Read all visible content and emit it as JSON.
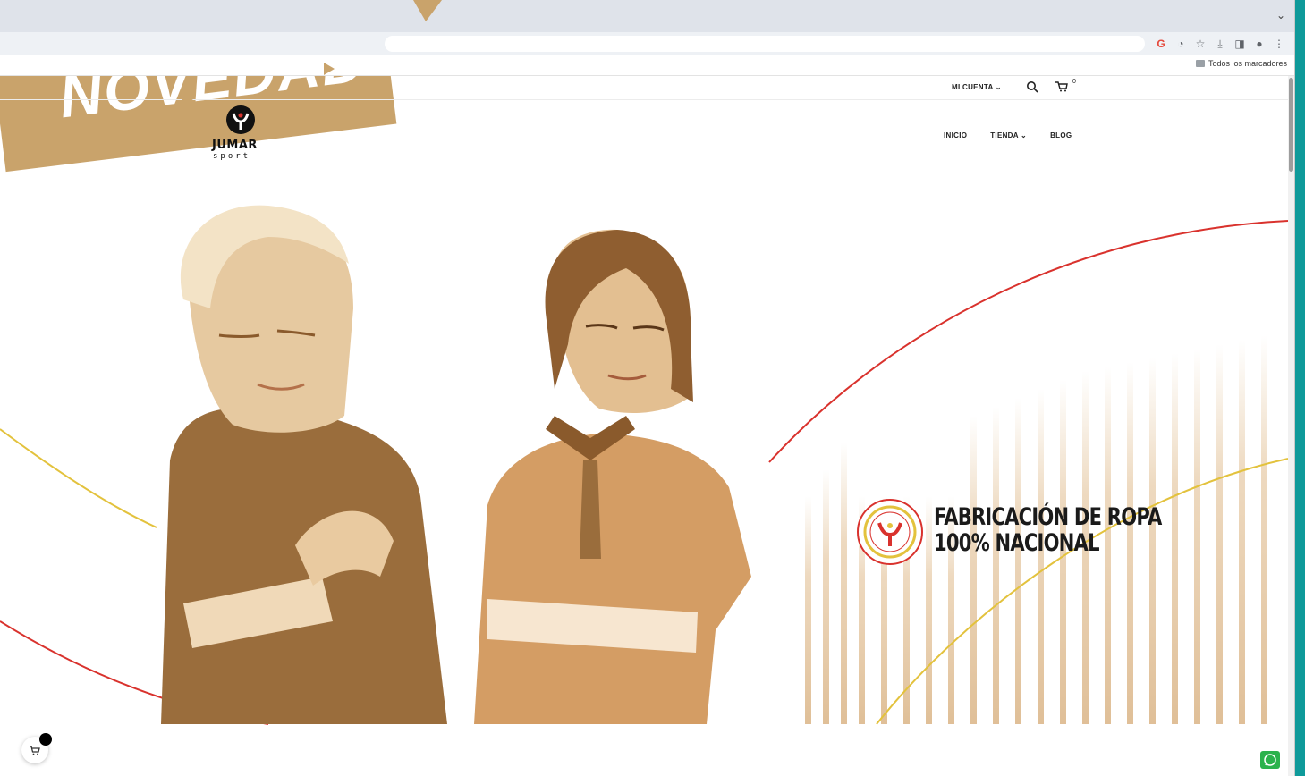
{
  "banner": {
    "text": "NOVEDAD"
  },
  "browser": {
    "bookmarks_label": "Todos los marcadores",
    "toolbar_icons": [
      "google-icon",
      "extension-icon",
      "star-icon",
      "download-icon",
      "sidepanel-icon",
      "profile-icon",
      "menu-icon"
    ]
  },
  "header": {
    "account_label": "MI CUENTA ⌄",
    "cart_count": "0"
  },
  "logo": {
    "word": "JUMAR",
    "sub": "sport"
  },
  "nav": {
    "items": [
      {
        "label": "INICIO"
      },
      {
        "label": "TIENDA ⌄"
      },
      {
        "label": "BLOG"
      }
    ]
  },
  "hero": {
    "headline_line1": "FABRICACIÓN DE ROPA",
    "headline_line2": "100% NACIONAL"
  },
  "colors": {
    "brand_tan": "#c9a36b",
    "accent_red": "#d9322d",
    "accent_yellow": "#e3c23d",
    "frame_teal": "#0f9a9a",
    "whatsapp_green": "#2bb24c"
  }
}
